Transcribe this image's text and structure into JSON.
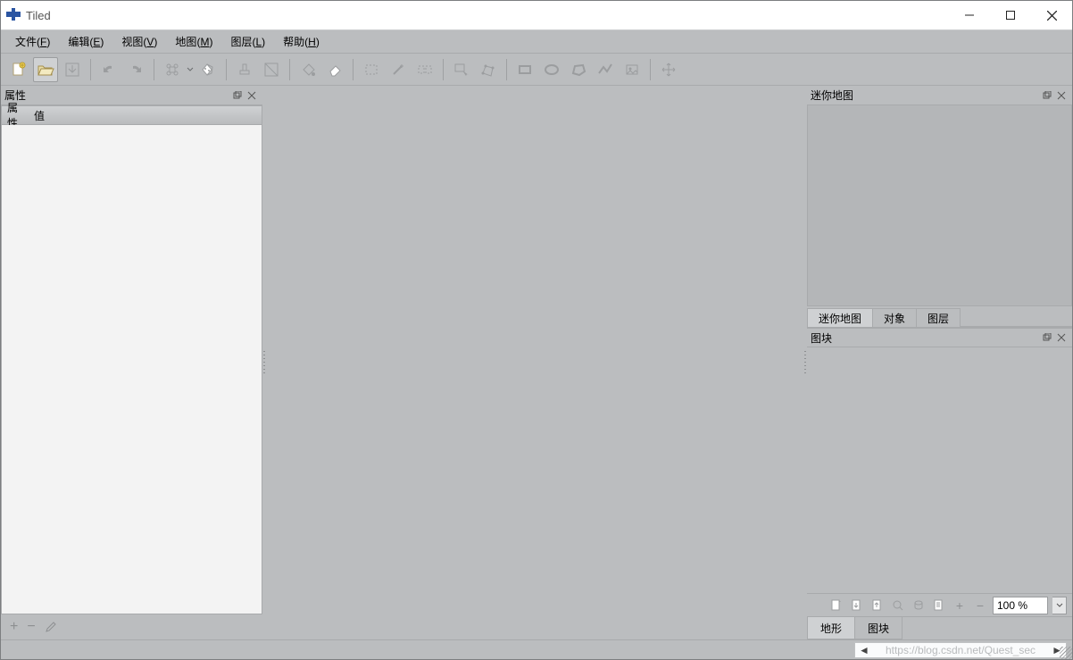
{
  "window": {
    "title": "Tiled"
  },
  "menu": {
    "file": {
      "label": "文件",
      "hotkey": "F"
    },
    "edit": {
      "label": "编辑",
      "hotkey": "E"
    },
    "view": {
      "label": "视图",
      "hotkey": "V"
    },
    "map": {
      "label": "地图",
      "hotkey": "M"
    },
    "layer": {
      "label": "图层",
      "hotkey": "L"
    },
    "help": {
      "label": "帮助",
      "hotkey": "H"
    }
  },
  "toolbar": {
    "new": "new-file",
    "open": "open-file",
    "save": "save-file",
    "undo": "undo",
    "redo": "redo",
    "command": "command",
    "random": "random",
    "layer_up": "layer-up",
    "rename": "rename",
    "bucket": "bucket-fill",
    "eraser": "eraser",
    "rect_select": "rectangle-select",
    "wand": "magic-wand",
    "stamp": "stamp",
    "object_select": "select-objects",
    "edit_poly": "edit-polygon",
    "rect_obj": "insert-rectangle",
    "ellipse_obj": "insert-ellipse",
    "polygon_obj": "insert-polygon",
    "polyline_obj": "insert-polyline",
    "tile_obj": "insert-tile",
    "move": "move"
  },
  "panels": {
    "properties": {
      "title": "属性",
      "col_name": "属性",
      "col_value": "值",
      "footer_add": "+",
      "footer_remove": "−",
      "footer_edit": "edit"
    },
    "minimap": {
      "title": "迷你地图",
      "tabs": {
        "minimap": "迷你地图",
        "objects": "对象",
        "layers": "图层"
      }
    },
    "tilesets": {
      "title": "图块",
      "bottom_tabs": {
        "terrain": "地形",
        "tiles": "图块"
      },
      "zoom_value": "100 %"
    }
  },
  "statusbar": {
    "watermark": "https://blog.csdn.net/Quest_sec"
  }
}
